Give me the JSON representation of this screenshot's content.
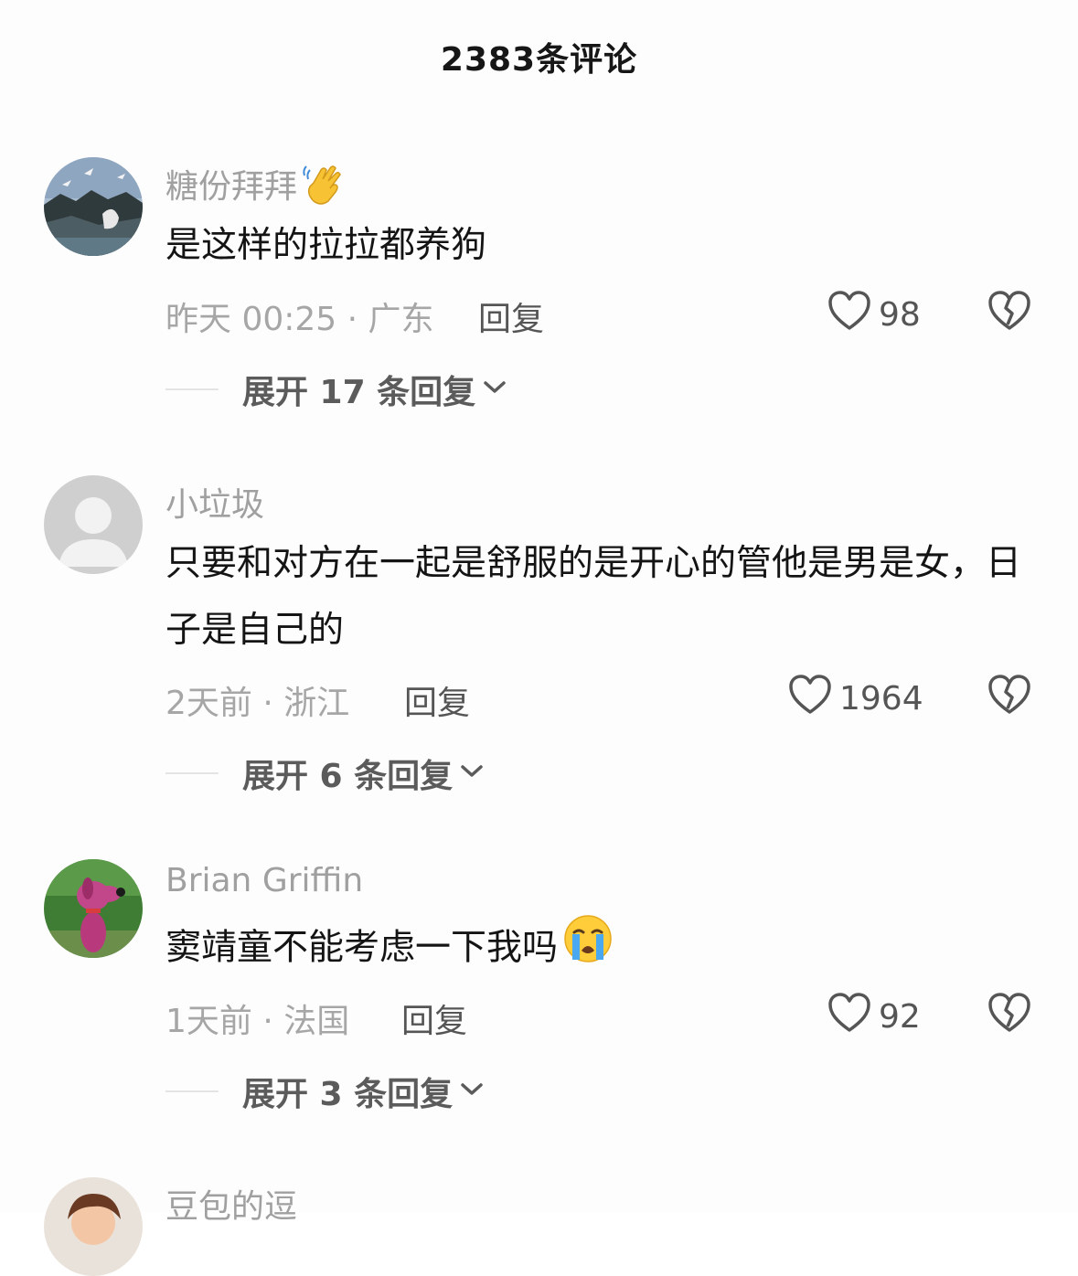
{
  "header": {
    "title": "2383条评论"
  },
  "comments": [
    {
      "username": "糖份拜拜",
      "username_emoji": "waving-hand-emoji",
      "text": "是这样的拉拉都养狗",
      "meta": "昨天 00:25 · 广东",
      "reply_label": "回复",
      "likes": "98",
      "expand_label": "展开 17 条回复"
    },
    {
      "username": "小垃圾",
      "text": "只要和对方在一起是舒服的是开心的管他是男是女，日子是自己的",
      "meta": "2天前 · 浙江",
      "reply_label": "回复",
      "likes": "1964",
      "expand_label": "展开 6 条回复"
    },
    {
      "username": "Brian Griffin",
      "text": "窦靖童不能考虑一下我吗",
      "text_emoji": "crying-face-emoji",
      "meta": "1天前 · 法国",
      "reply_label": "回复",
      "likes": "92",
      "expand_label": "展开 3 条回复"
    },
    {
      "username": "豆包的逗"
    }
  ],
  "icons": {
    "like": "heart-outline-icon",
    "dislike": "broken-heart-icon",
    "expand": "chevron-down-icon"
  },
  "colors": {
    "text": "#141414",
    "muted": "#a6a6a6",
    "action": "#555555"
  }
}
